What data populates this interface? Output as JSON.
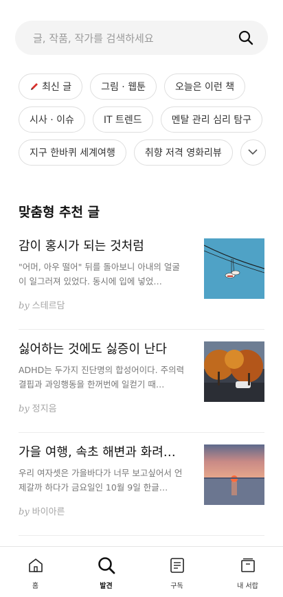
{
  "search": {
    "placeholder": "글, 작품, 작가를 검색하세요",
    "icon": "search-icon"
  },
  "keywords": {
    "row1": [
      "최신 글",
      "그림 · 웹툰",
      "오늘은 이런 책"
    ],
    "row2": [
      "시사 · 이슈",
      "IT 트렌드",
      "멘탈 관리 심리 탐구"
    ],
    "row3": [
      "지구 한바퀴 세계여행",
      "취향 저격 영화리뷰"
    ],
    "more_icon": "chevron-down-icon"
  },
  "recommend": {
    "title": "맞춤형 추천 글",
    "by_label": "by",
    "items": [
      {
        "title": "감이 홍시가 되는 것처럼",
        "desc": "\"어머, 아우 떨어\" 뒤를 돌아보니 아내의 얼굴이 일그러져 있었다. 동시에 입에 넣었…",
        "author": "스테르담"
      },
      {
        "title": "싫어하는 것에도 싫증이 난다",
        "desc": "ADHD는 두가지 진단명의 합성어이다. 주의력 결핍과 과잉행동을 한꺼번에 일컫기 때…",
        "author": "정지음"
      },
      {
        "title": "가을 여행, 속초 해변과 화려한…",
        "desc": "우리 여자셋은 가을바다가 너무 보고싶어서 언제갈까 하다가 금요일인 10월 9일 한글…",
        "author": "바이아른"
      }
    ]
  },
  "tabbar": {
    "items": [
      {
        "label": "홈",
        "icon": "home-icon"
      },
      {
        "label": "발견",
        "icon": "search-icon"
      },
      {
        "label": "구독",
        "icon": "subscribe-icon"
      },
      {
        "label": "내 서랍",
        "icon": "drawer-icon"
      }
    ],
    "active": "발견"
  },
  "colors": {
    "accent": "#d9302c",
    "chip_border": "#dedede",
    "search_bg": "#f4f4f4"
  }
}
